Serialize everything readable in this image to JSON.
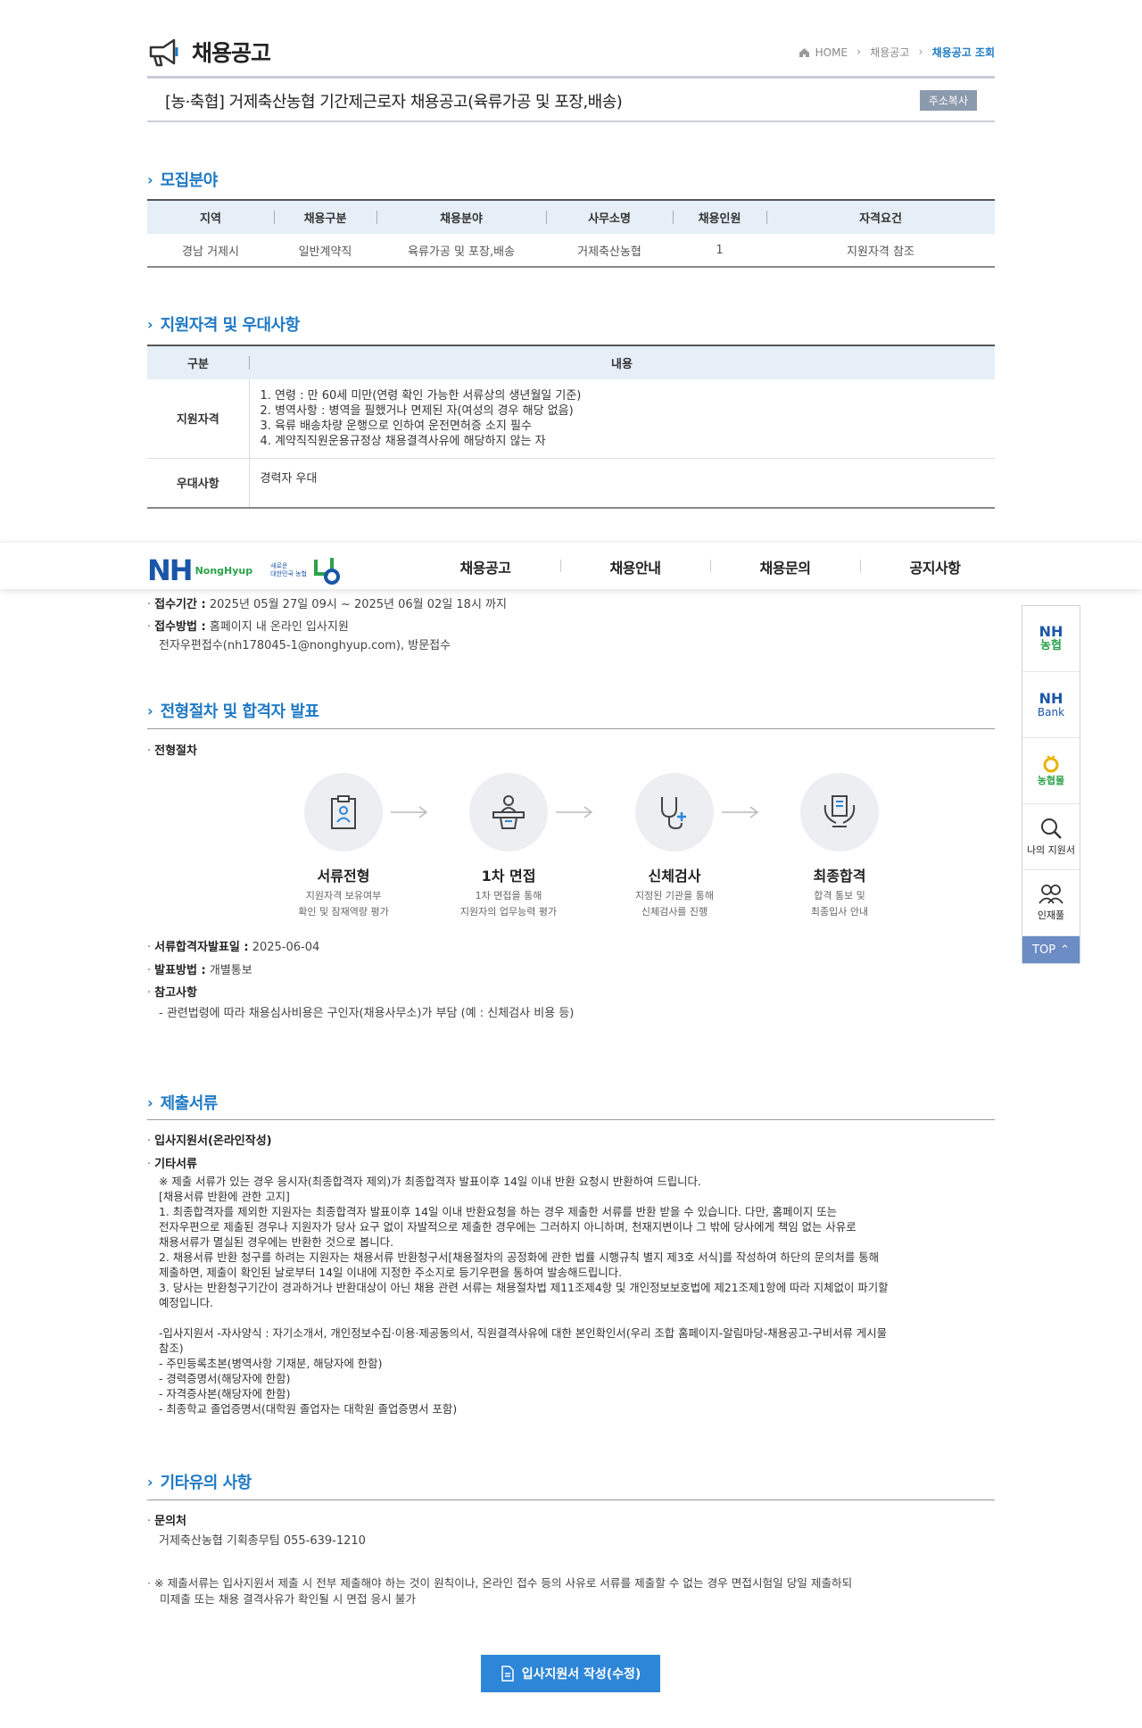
{
  "header": {
    "title": "채용공고",
    "breadcrumb": [
      "HOME",
      "채용공고",
      "채용공고 조회"
    ]
  },
  "posting": {
    "title": "[농·축협] 거제축산농협 기간제근로자 채용공고(육류가공 및 포장,배송)",
    "copy_label": "주소복사"
  },
  "recruit": {
    "heading": "모집분야",
    "columns": [
      "지역",
      "채용구분",
      "채용분야",
      "사무소명",
      "채용인원",
      "자격요건"
    ],
    "row": [
      "경남 거제시",
      "일반계약직",
      "육류가공 및 포장,배송",
      "거제축산농협",
      "1",
      "지원자격 참조"
    ]
  },
  "qualification": {
    "heading": "지원자격 및 우대사항",
    "columns": [
      "구분",
      "내용"
    ],
    "req_label": "지원자격",
    "req_lines": [
      "1. 연령 : 만 60세 미만(연령 확인 가능한 서류상의 생년월일 기준)",
      "2. 병역사항 : 병역을 필했거나 면제된 자(여성의 경우 해당 없음)",
      "3. 육류 배송차량 운행으로 인하여 운전면허증 소지 필수",
      "4. 계약직직원운용규정상 채용결격사유에 해당하지 않는 자"
    ],
    "pref_label": "우대사항",
    "pref_value": "경력자 우대"
  },
  "nav": {
    "brand": "NH",
    "brand_sub": "NongHyup",
    "slogan_1": "새로운",
    "slogan_2": "대한민국 농협",
    "items": [
      "채용공고",
      "채용안내",
      "채용문의",
      "공지사항"
    ]
  },
  "reception": {
    "period_label": "접수기간 :",
    "period": "2025년 05월 27일 09시 ~ 2025년 06월 02일 18시 까지",
    "method_label": "접수방법 :",
    "method": "홈페이지 내 온라인 입사지원",
    "method_2": "전자우편접수(nh178045-1@nonghyup.com), 방문접수"
  },
  "procedure": {
    "heading": "전형절차 및 합격자 발표",
    "sub": "전형절차",
    "steps": [
      {
        "name": "서류전형",
        "d1": "지원자격 보유여부",
        "d2": "확인 및 잠재역량 평가"
      },
      {
        "name": "1차 면접",
        "d1": "1차 면접을 통해",
        "d2": "지원자의 업무능력 평가"
      },
      {
        "name": "신체검사",
        "d1": "지정된 기관을 통해",
        "d2": "신체검사를 진행"
      },
      {
        "name": "최종합격",
        "d1": "합격 통보 및",
        "d2": "최종입사 안내"
      }
    ],
    "announce_label": "서류합격자발표일 :",
    "announce_date": "2025-06-04",
    "notify_label": "발표방법 :",
    "notify_value": "개별통보",
    "note_label": "참고사항",
    "note": "- 관련법령에 따라 채용심사비용은 구인자(채용사무소)가 부담 (예 : 신체검사 비용 등)"
  },
  "documents": {
    "heading": "제출서류",
    "item1": "입사지원서(온라인작성)",
    "item2": "기타서류",
    "lines": [
      "※ 제출 서류가 있는 경우 응시자(최종합격자 제외)가 최종합격자 발표이후 14일 이내 반환 요청시 반환하여 드립니다.",
      "[채용서류 반환에 관한 고지]",
      " 1. 최종합격자를 제외한 지원자는 최종합격자 발표이후 14일 이내 반환요청을 하는 경우 제출한 서류를 반환 받을 수 있습니다. 다만, 홈페이지 또는",
      "전자우편으로 제출된 경우나 지원자가 당사 요구 없이 자발적으로 제출한 경우에는 그러하지 아니하며, 천재지변이나 그 밖에 당사에게 책임 없는 사유로",
      "채용서류가 멸실된 경우에는 반환한 것으로 봅니다.",
      " 2. 채용서류 반환 청구를 하려는 지원자는 채용서류 반환청구서[채용절차의 공정화에 관한 법률 시행규칙 별지 제3호 서식]를 작성하여 하단의 문의처를 통해",
      "제출하면, 제출이 확인된 날로부터 14일 이내에 지정한 주소지로 등기우편을 통하여 발송해드립니다.",
      " 3. 당사는 반환청구기간이 경과하거나 반환대상이 아닌 채용 관련 서류는 채용절차법 제11조제4항 및 개인정보보호법에 제21조제1항에 따라 지체없이 파기할",
      "예정입니다.",
      "",
      " -입사지원서 -자사양식 : 자기소개서, 개인정보수집·이용·제공동의서, 직원결격사유에 대한 본인확인서(우리 조합 홈페이지-알림마당-채용공고-구비서류 게시물",
      "참조)",
      "- 주민등록초본(병역사항 기재분, 해당자에 한함)",
      "- 경력증명서(해당자에 한함)",
      "- 자격증사본(해당자에 한함)",
      "- 최종학교 졸업증명서(대학원 졸업자는 대학원 졸업증명서 포함)"
    ]
  },
  "etc": {
    "heading": "기타유의 사항",
    "contact_label": "문의처",
    "contact": "거제축산농협 기획총무팀 055-639-1210",
    "note_1": "※ 제출서류는 입사지원서 제출 시 전부 제출해야 하는 것이 원칙이나, 온라인 접수 등의 사유로 서류를 제출할 수 없는 경우 면접시험일 당일 제출하되",
    "note_2": "미제출 또는 채용 결격사유가 확인될 시 면접 응시 불가"
  },
  "quick": {
    "nh_top": "NH",
    "nh_sub": "농협",
    "bank_top": "NH",
    "bank_sub": "Bank",
    "mall": "농협몰",
    "my": "나의 지원서",
    "pool": "인재풀",
    "top": "TOP"
  },
  "apply_label": "입사지원서 작성(수정)"
}
